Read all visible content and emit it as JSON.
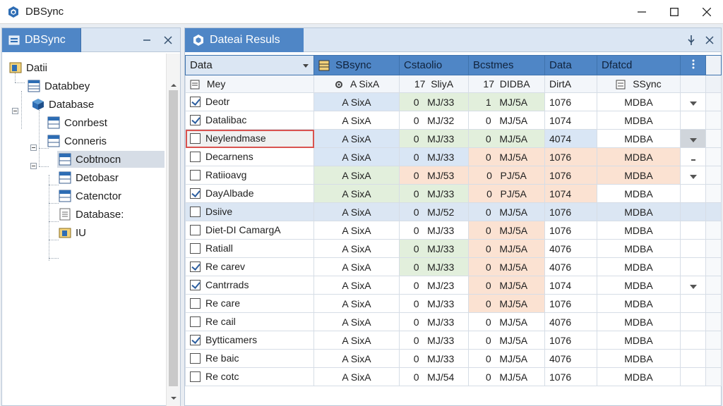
{
  "window": {
    "title": "DBSync"
  },
  "left_pane": {
    "tab_label": "DBSync",
    "tree": [
      {
        "label": "Datii"
      },
      {
        "label": "Databbey"
      },
      {
        "label": "Database"
      },
      {
        "label": "Conrbest"
      },
      {
        "label": "Conneris"
      },
      {
        "label": "Cobtnocn"
      },
      {
        "label": "Detobasr"
      },
      {
        "label": "Catenctor"
      },
      {
        "label": "Database:"
      },
      {
        "label": "IU"
      }
    ]
  },
  "right_pane": {
    "tab_label": "Dateai Resuls",
    "headers": [
      "Data",
      "SBsync",
      "Cstaolio",
      "Bcstmes",
      "Data",
      "Dfatcd"
    ],
    "subheaders": {
      "name": "Mey",
      "col_a": "A SixA",
      "col_b_num": "17",
      "col_b": "SliyA",
      "col_c_num": "17",
      "col_c": "DIDBA",
      "col_d": "DirtA",
      "col_e": "SSync"
    },
    "rows": [
      {
        "checked": true,
        "name": "Deotr",
        "a": "A SixA",
        "bn": "0",
        "bv": "MJ/33",
        "cn": "1",
        "cv": "MJ/5A",
        "d": "1076",
        "e": "MDBA"
      },
      {
        "checked": true,
        "name": "Datalibac",
        "a": "A SixA",
        "bn": "0",
        "bv": "MJ/32",
        "cn": "0",
        "cv": "MJ/5A",
        "d": "1074",
        "e": "MDBA"
      },
      {
        "checked": false,
        "name": "Neylendmase",
        "a": "A SixA",
        "bn": "0",
        "bv": "MJ/33",
        "cn": "0",
        "cv": "MJ/5A",
        "d": "4074",
        "e": "MDBA"
      },
      {
        "checked": false,
        "name": "Decarnens",
        "a": "A SixA",
        "bn": "0",
        "bv": "MJ/33",
        "cn": "0",
        "cv": "MJ/5A",
        "d": "1076",
        "e": "MDBA"
      },
      {
        "checked": false,
        "name": "Ratiioavg",
        "a": "A SixA",
        "bn": "0",
        "bv": "MJ/53",
        "cn": "0",
        "cv": "PJ/5A",
        "d": "1076",
        "e": "MDBA"
      },
      {
        "checked": true,
        "name": "DayAlbade",
        "a": "A SixA",
        "bn": "0",
        "bv": "MJ/33",
        "cn": "0",
        "cv": "PJ/5A",
        "d": "1074",
        "e": "MDBA"
      },
      {
        "checked": false,
        "name": "Dsiive",
        "a": "A SixA",
        "bn": "0",
        "bv": "MJ/52",
        "cn": "0",
        "cv": "MJ/5A",
        "d": "1076",
        "e": "MDBA"
      },
      {
        "checked": false,
        "name": "Diet-DI CamargA",
        "a": "A SixA",
        "bn": "0",
        "bv": "MJ/33",
        "cn": "0",
        "cv": "MJ/5A",
        "d": "1076",
        "e": "MDBA"
      },
      {
        "checked": false,
        "name": "Ratiall",
        "a": "A SixA",
        "bn": "0",
        "bv": "MJ/33",
        "cn": "0",
        "cv": "MJ/5A",
        "d": "4076",
        "e": "MDBA"
      },
      {
        "checked": true,
        "name": "Re carev",
        "a": "A SixA",
        "bn": "0",
        "bv": "MJ/33",
        "cn": "0",
        "cv": "MJ/5A",
        "d": "4076",
        "e": "MDBA"
      },
      {
        "checked": true,
        "name": "Cantrrads",
        "a": "A SixA",
        "bn": "0",
        "bv": "MJ/23",
        "cn": "0",
        "cv": "MJ/5A",
        "d": "1074",
        "e": "MDBA"
      },
      {
        "checked": false,
        "name": "Re care",
        "a": "A SixA",
        "bn": "0",
        "bv": "MJ/33",
        "cn": "0",
        "cv": "MJ/5A",
        "d": "1076",
        "e": "MDBA"
      },
      {
        "checked": false,
        "name": "Re cail",
        "a": "A SixA",
        "bn": "0",
        "bv": "MJ/33",
        "cn": "0",
        "cv": "MJ/5A",
        "d": "4076",
        "e": "MDBA"
      },
      {
        "checked": true,
        "name": "Bytticamers",
        "a": "A SixA",
        "bn": "0",
        "bv": "MJ/33",
        "cn": "0",
        "cv": "MJ/5A",
        "d": "1076",
        "e": "MDBA"
      },
      {
        "checked": false,
        "name": "Re baic",
        "a": "A SixA",
        "bn": "0",
        "bv": "MJ/33",
        "cn": "0",
        "cv": "MJ/5A",
        "d": "4076",
        "e": "MDBA"
      },
      {
        "checked": false,
        "name": "Re cotc",
        "a": "A SixA",
        "bn": "0",
        "bv": "MJ/54",
        "cn": "0",
        "cv": "MJ/5A",
        "d": "1076",
        "e": "MDBA"
      }
    ]
  },
  "colors": {
    "accent": "#4f86c6",
    "header_bg": "#dbe6f3",
    "highlight_border": "#d9534f"
  }
}
